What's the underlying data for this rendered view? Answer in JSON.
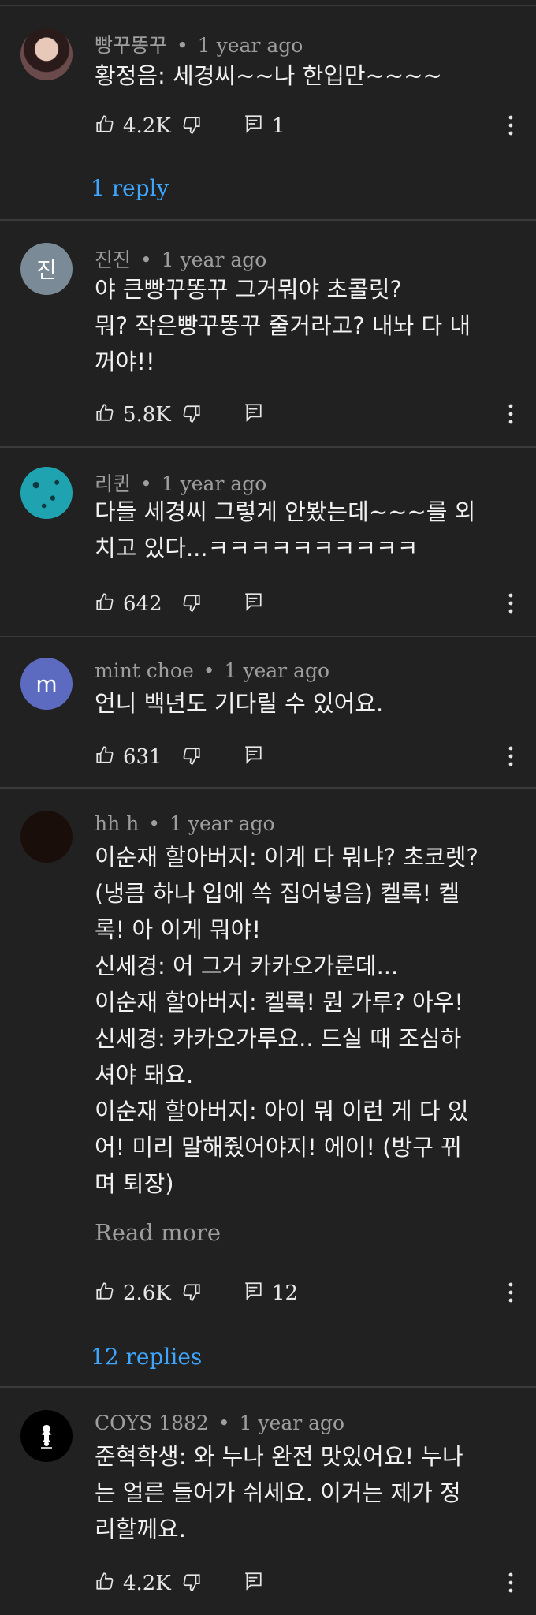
{
  "comments": [
    {
      "author": "빵꾸똥꾸",
      "time": "1 year ago",
      "text": "황정음: 세경씨~~나 한입만~~~~",
      "likes": "4.2K",
      "reply_count": "1",
      "replies_label": "1 reply",
      "avatar": {
        "type": "photo",
        "color": "#5a3a3a"
      }
    },
    {
      "author": "진진",
      "time": "1 year ago",
      "text": "야 큰빵꾸똥꾸 그거뭐야 초콜릿?\n뭐? 작은빵꾸똥꾸 줄거라고? 내놔 다 내\n꺼야!!",
      "likes": "5.8K",
      "avatar": {
        "type": "letter",
        "letter": "진",
        "color": "#7a8a96"
      }
    },
    {
      "author": "리퀸",
      "time": "1 year ago",
      "text": "다들 세경씨 그렇게 안봤는데~~~를 외\n치고 있다...ㅋㅋㅋㅋㅋㅋㅋㅋㅋㅋ",
      "likes": "642",
      "avatar": {
        "type": "photo",
        "color": "#1fa3b0"
      }
    },
    {
      "author": "mint choe",
      "time": "1 year ago",
      "text": "언니 백년도 기다릴 수 있어요.",
      "likes": "631",
      "avatar": {
        "type": "letter",
        "letter": "m",
        "color": "#5c6bc0"
      }
    },
    {
      "author": "hh h",
      "time": "1 year ago",
      "text": "이순재 할아버지: 이게 다 뭐냐? 초코렛?\n(냉큼 하나 입에 쏙 집어넣음) 켈록! 켈\n록! 아 이게 뭐야!\n신세경: 어 그거 카카오가룬데...\n이순재 할아버지: 켈록! 뭔 가루? 아우!\n신세경: 카카오가루요.. 드실 때 조심하\n셔야 돼요.\n이순재 할아버지: 아이 뭐 이런 게 다 있\n어! 미리 말해줬어야지! 에이! (방구 뀌\n며 퇴장)",
      "read_more": "Read more",
      "likes": "2.6K",
      "reply_count": "12",
      "replies_label": "12 replies",
      "avatar": {
        "type": "photo",
        "color": "#1a0e0a"
      }
    },
    {
      "author": "COYS 1882",
      "time": "1 year ago",
      "text": "준혁학생: 와 누나 완전 맛있어요! 누나\n는 얼른 들어가 쉬세요. 이거는 제가 정\n리할께요.",
      "likes": "4.2K",
      "avatar": {
        "type": "photo",
        "color": "#000000"
      }
    }
  ],
  "colors": {
    "background": "#212121",
    "text": "#f1f1f1",
    "meta": "#9e9e9e",
    "link": "#3ea6ff",
    "divider": "#3a3a3a"
  }
}
